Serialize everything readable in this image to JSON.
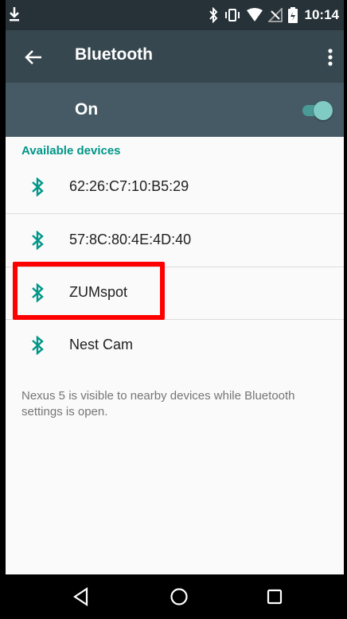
{
  "status_bar": {
    "time": "10:14",
    "icons": [
      "download-icon",
      "bluetooth-icon",
      "vibrate-icon",
      "wifi-icon",
      "no-signal-icon",
      "battery-icon"
    ]
  },
  "toolbar": {
    "title": "Bluetooth",
    "back_icon": "arrow-back-icon",
    "menu_icon": "overflow-menu-icon"
  },
  "bluetooth_switch": {
    "label": "On",
    "state": true
  },
  "available_devices": {
    "header": "Available devices",
    "devices": [
      {
        "name": "62:26:C7:10:B5:29",
        "icon": "bluetooth-icon"
      },
      {
        "name": "57:8C:80:4E:4D:40",
        "icon": "bluetooth-icon"
      },
      {
        "name": "ZUMspot",
        "icon": "bluetooth-icon",
        "highlighted": true
      },
      {
        "name": "Nest Cam",
        "icon": "bluetooth-icon"
      }
    ]
  },
  "visibility_note": "Nexus 5 is visible to nearby devices while Bluetooth settings is open.",
  "nav_bar": {
    "buttons": [
      "back-triangle-icon",
      "home-circle-icon",
      "recents-square-icon"
    ]
  },
  "colors": {
    "status_bar": "#263238",
    "toolbar": "#37474f",
    "switch_bar": "#455a64",
    "accent": "#009688",
    "highlight": "#ff0000"
  }
}
